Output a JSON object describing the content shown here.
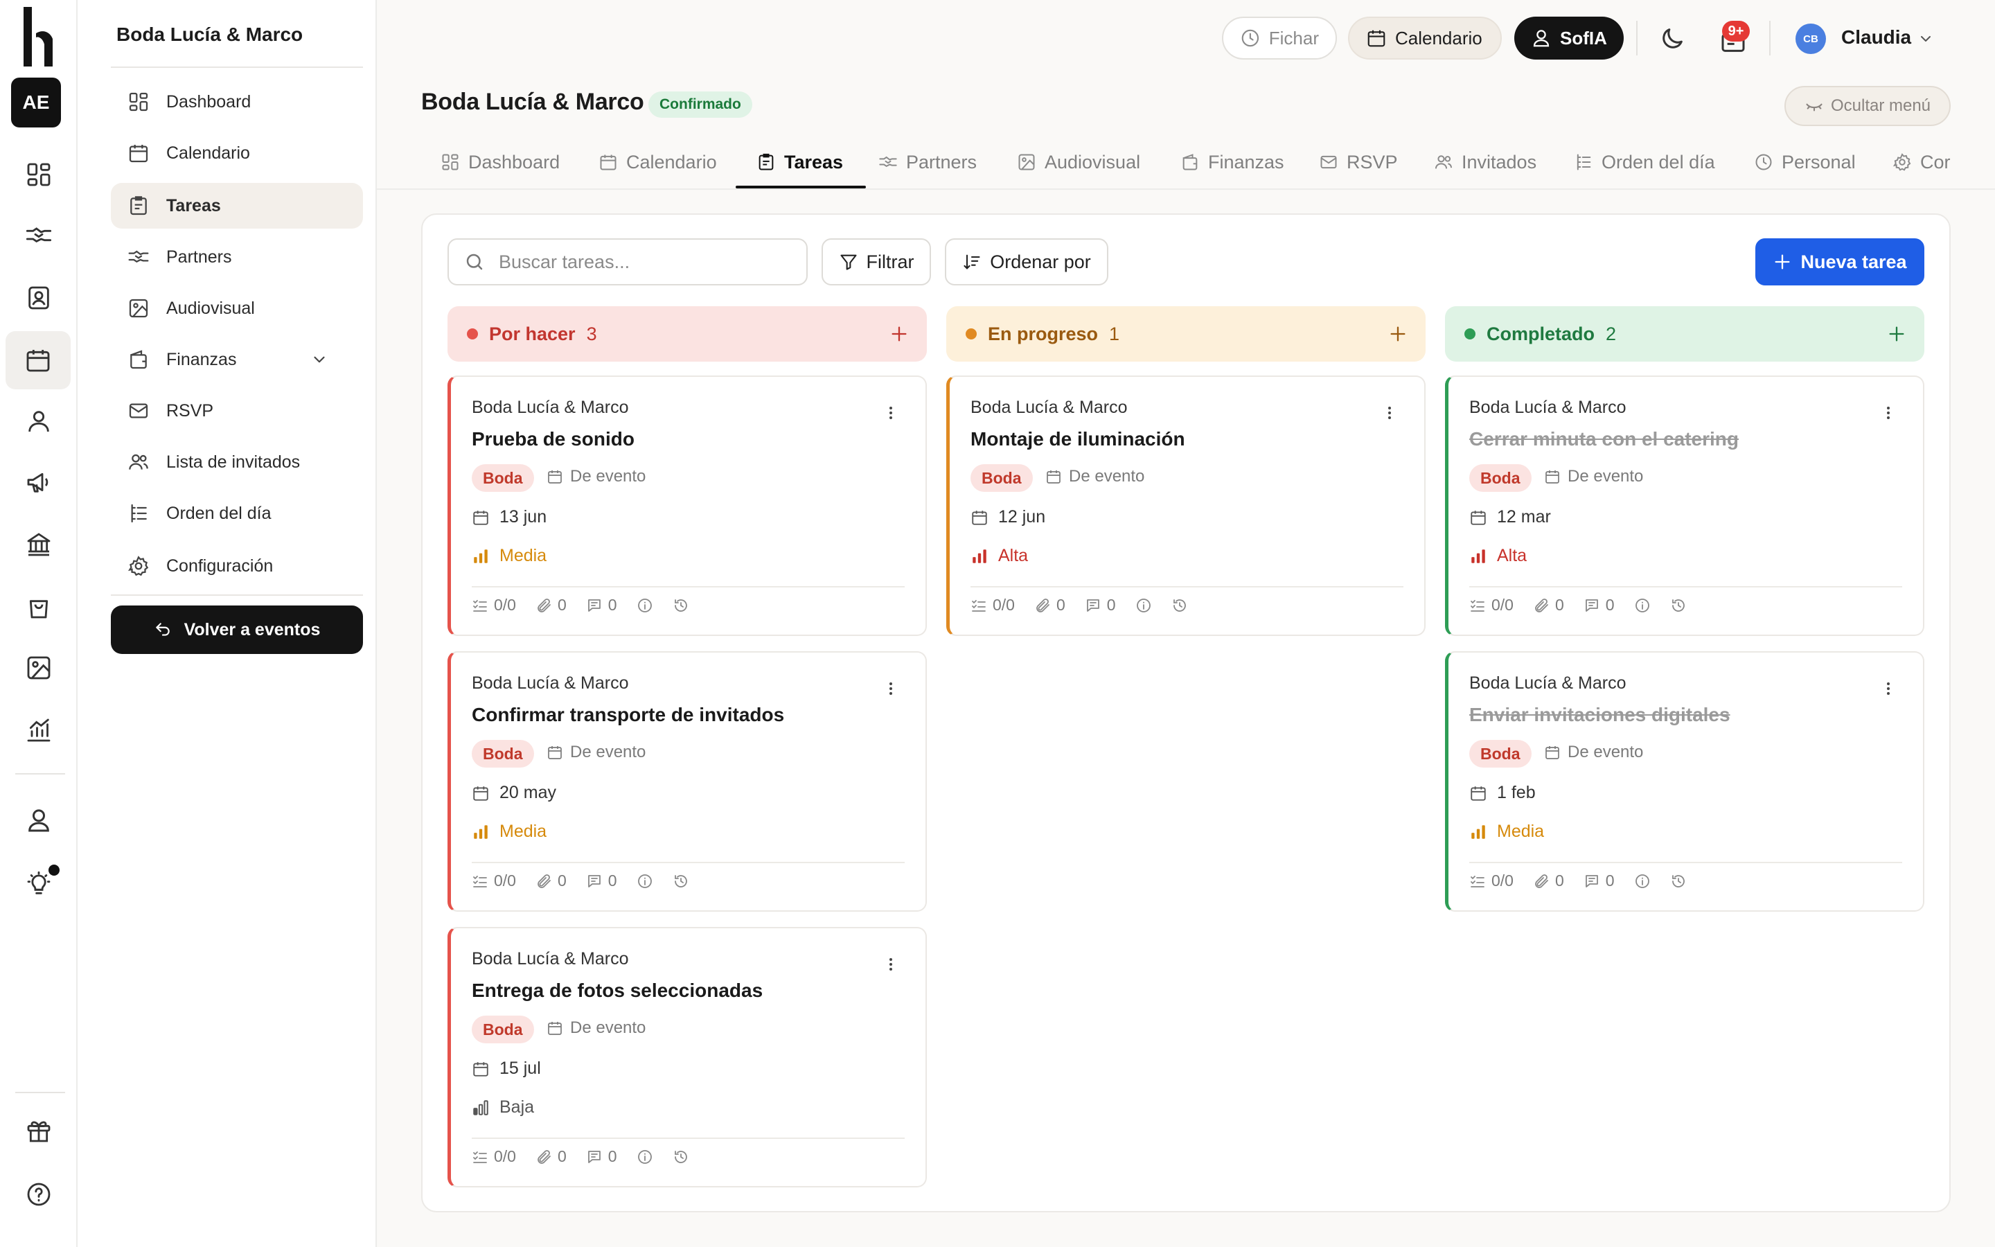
{
  "rail": {
    "workspace_initials": "AE"
  },
  "sidebar": {
    "title": "Boda Lucía & Marco",
    "items": [
      {
        "label": "Dashboard",
        "icon": "dashboard-icon"
      },
      {
        "label": "Calendario",
        "icon": "calendar-icon"
      },
      {
        "label": "Tareas",
        "icon": "tasks-icon",
        "active": true
      },
      {
        "label": "Partners",
        "icon": "handshake-icon"
      },
      {
        "label": "Audiovisual",
        "icon": "image-icon"
      },
      {
        "label": "Finanzas",
        "icon": "wallet-icon"
      },
      {
        "label": "RSVP",
        "icon": "mail-icon"
      },
      {
        "label": "Lista de invitados",
        "icon": "users-icon"
      },
      {
        "label": "Orden del día",
        "icon": "agenda-icon"
      },
      {
        "label": "Configuración",
        "icon": "gear-icon"
      }
    ],
    "back_label": "Volver a eventos"
  },
  "topbar": {
    "fichar": "Fichar",
    "calendario": "Calendario",
    "sofia": "SofIA",
    "notif_badge": "9+",
    "avatar_initials": "CB",
    "user_name": "Claudia"
  },
  "header": {
    "title": "Boda Lucía & Marco",
    "status": "Confirmado",
    "hide_menu": "Ocultar menú"
  },
  "tabs": [
    {
      "label": "Dashboard"
    },
    {
      "label": "Calendario"
    },
    {
      "label": "Tareas",
      "active": true
    },
    {
      "label": "Partners"
    },
    {
      "label": "Audiovisual"
    },
    {
      "label": "Finanzas"
    },
    {
      "label": "RSVP"
    },
    {
      "label": "Invitados"
    },
    {
      "label": "Orden del día"
    },
    {
      "label": "Personal"
    },
    {
      "label": "Cor"
    }
  ],
  "toolbar": {
    "search_placeholder": "Buscar tareas...",
    "filter_label": "Filtrar",
    "sort_label": "Ordenar por",
    "new_label": "Nueva tarea"
  },
  "colors": {
    "todo": "#e5534b",
    "todo_bg": "#fbe3e1",
    "todo_text": "#c2362f",
    "progress": "#e08a22",
    "progress_bg": "#fdf0da",
    "progress_text": "#9a5a10",
    "done": "#2e9d55",
    "done_bg": "#dff3e5",
    "done_text": "#1f7a40",
    "accent": "#1f5ee6",
    "prio_media": "#d68a0c",
    "prio_alta": "#c8322b",
    "prio_baja": "#555555"
  },
  "columns": [
    {
      "title": "Por hacer",
      "count": "3",
      "cards": [
        {
          "project": "Boda Lucía & Marco",
          "title": "Prueba de sonido",
          "tag": "Boda",
          "kind": "De evento",
          "date": "13 jun",
          "priority": "Media",
          "checklist": "0/0",
          "attachments": "0",
          "comments": "0",
          "done": false
        },
        {
          "project": "Boda Lucía & Marco",
          "title": "Confirmar transporte de invitados",
          "tag": "Boda",
          "kind": "De evento",
          "date": "20 may",
          "priority": "Media",
          "checklist": "0/0",
          "attachments": "0",
          "comments": "0",
          "done": false
        },
        {
          "project": "Boda Lucía & Marco",
          "title": "Entrega de fotos seleccionadas",
          "tag": "Boda",
          "kind": "De evento",
          "date": "15 jul",
          "priority": "Baja",
          "checklist": "0/0",
          "attachments": "0",
          "comments": "0",
          "done": false
        }
      ]
    },
    {
      "title": "En progreso",
      "count": "1",
      "cards": [
        {
          "project": "Boda Lucía & Marco",
          "title": "Montaje de iluminación",
          "tag": "Boda",
          "kind": "De evento",
          "date": "12 jun",
          "priority": "Alta",
          "checklist": "0/0",
          "attachments": "0",
          "comments": "0",
          "done": false
        }
      ]
    },
    {
      "title": "Completado",
      "count": "2",
      "cards": [
        {
          "project": "Boda Lucía & Marco",
          "title": "Cerrar minuta con el catering",
          "tag": "Boda",
          "kind": "De evento",
          "date": "12 mar",
          "priority": "Alta",
          "checklist": "0/0",
          "attachments": "0",
          "comments": "0",
          "done": true
        },
        {
          "project": "Boda Lucía & Marco",
          "title": "Enviar invitaciones digitales",
          "tag": "Boda",
          "kind": "De evento",
          "date": "1 feb",
          "priority": "Media",
          "checklist": "0/0",
          "attachments": "0",
          "comments": "0",
          "done": true
        }
      ]
    }
  ]
}
